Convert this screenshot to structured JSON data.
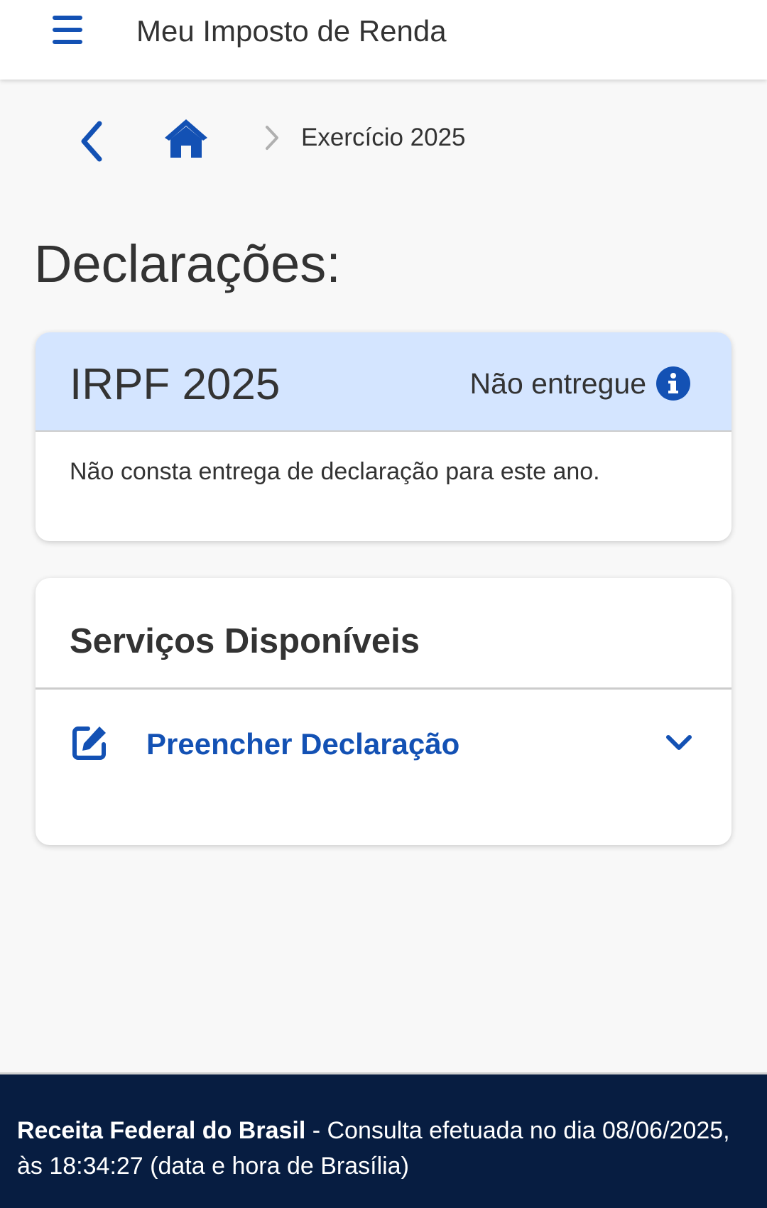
{
  "header": {
    "menu_icon": "hamburger-menu-icon",
    "title": "Meu Imposto de Renda"
  },
  "breadcrumb": {
    "back_icon": "chevron-left-icon",
    "home_icon": "home-icon",
    "separator_icon": "chevron-right-icon",
    "current": "Exercício 2025"
  },
  "page": {
    "title": "Declarações:"
  },
  "declaration_card": {
    "title": "IRPF 2025",
    "status": "Não entregue",
    "status_icon": "info-icon",
    "message": "Não consta entrega de declaração para este ano."
  },
  "services_card": {
    "title": "Serviços Disponíveis",
    "items": [
      {
        "icon": "edit-icon",
        "label": "Preencher Declaração",
        "toggle_icon": "chevron-down-icon"
      }
    ]
  },
  "footer": {
    "org": "Receita Federal do Brasil",
    "text": " - Consulta efetuada no dia 08/06/2025, às 18:34:27 (data e hora de Brasília)"
  },
  "colors": {
    "primary": "#1351b4",
    "header_card_bg": "#d4e5ff",
    "footer_bg": "#071d41",
    "page_bg": "#f8f8f8"
  }
}
